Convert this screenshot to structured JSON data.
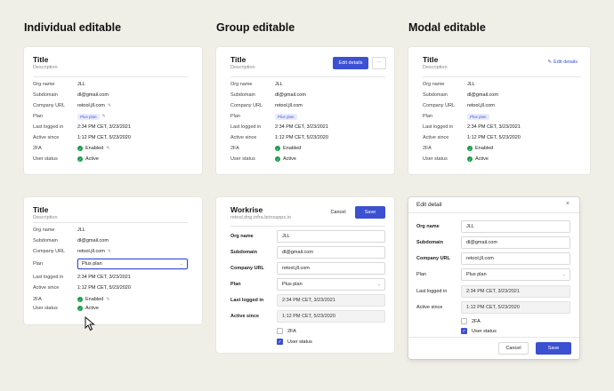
{
  "headings": {
    "individual": "Individual editable",
    "group": "Group editable",
    "modal": "Modal editable"
  },
  "card": {
    "title": "Title",
    "description": "Description"
  },
  "fields": {
    "org_name_label": "Org name",
    "org_name": "JLL",
    "subdomain_label": "Subdomain",
    "subdomain": "dl@gmail.com",
    "company_url_label": "Company URL",
    "company_url": "retool.jll.com",
    "plan_label": "Plan",
    "plan": "Plus plan",
    "last_logged_label": "Last logged in",
    "last_logged": "2:34 PM CET, 3/23/2021",
    "active_since_label": "Active since",
    "active_since": "1:12 PM CET, 5/23/2020",
    "twofa_label": "2FA",
    "twofa": "Enabled",
    "user_status_label": "User status",
    "user_status": "Active"
  },
  "group": {
    "edit_button": "Edit details",
    "more_icon": "more-horizontal-icon"
  },
  "modal_card": {
    "edit_link": "Edit details"
  },
  "workrise": {
    "title": "Workrise",
    "subtitle": "retool.dng.infra.brinxapps.io",
    "cancel": "Cancel",
    "save": "Save",
    "org_name": "JLL",
    "plan": "Plus plan",
    "checkbox_2fa": "2FA",
    "checkbox_user_status": "User status"
  },
  "edit_modal": {
    "title": "Edit detail",
    "cancel": "Cancel",
    "save": "Save"
  },
  "colors": {
    "primary": "#3c50d2",
    "success": "#1a9c4a",
    "background": "#efefe7"
  }
}
